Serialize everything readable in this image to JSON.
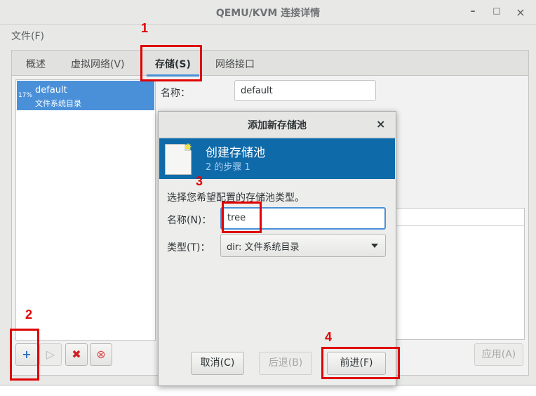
{
  "window": {
    "title": "QEMU/KVM 连接详情",
    "min": "–",
    "max": "□",
    "close": "×"
  },
  "menu": {
    "file": "文件(F)"
  },
  "tabs": [
    "概述",
    "虚拟网络(V)",
    "存储(S)",
    "网络接口"
  ],
  "pools": [
    {
      "usage": "17%",
      "name": "default",
      "type": "文件系统目录"
    }
  ],
  "details": {
    "name_label": "名称：",
    "name_value": "default"
  },
  "toolbar": {
    "add": "+",
    "start": "▷",
    "stop": "✖",
    "delete": "⊗",
    "apply": "应用(A)"
  },
  "dialog": {
    "title": "添加新存储池",
    "close": "×",
    "banner_title": "创建存储池",
    "banner_step": "2 的步骤 1",
    "instruction": "选择您希望配置的存储池类型。",
    "name_label": "名称(N)：",
    "name_value": "tree",
    "type_label": "类型(T)：",
    "type_value": "dir: 文件系统目录",
    "cancel": "取消(C)",
    "back": "后退(B)",
    "forward": "前进(F)"
  },
  "annotations": [
    "1",
    "2",
    "3",
    "4"
  ],
  "colors": {
    "accent": "#4a90d9",
    "banner": "#0f6aa9",
    "annotation": "#e00000"
  }
}
